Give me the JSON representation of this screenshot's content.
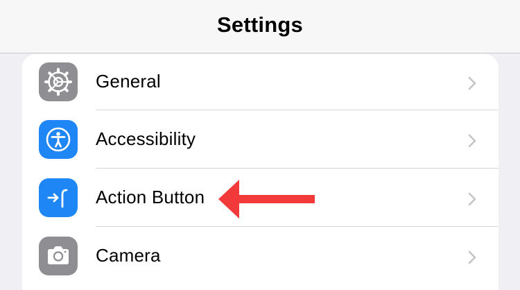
{
  "header": {
    "title": "Settings"
  },
  "rows": [
    {
      "label": "General",
      "icon": "gear-icon",
      "icon_bg": "#8e8e93"
    },
    {
      "label": "Accessibility",
      "icon": "accessibility-icon",
      "icon_bg": "#1f87f5"
    },
    {
      "label": "Action Button",
      "icon": "action-button-icon",
      "icon_bg": "#1f87f5"
    },
    {
      "label": "Camera",
      "icon": "camera-icon",
      "icon_bg": "#8e8e93"
    }
  ],
  "annotation": {
    "icon": "red-arrow-icon",
    "color": "#f23a3a",
    "points_to": "Action Button"
  },
  "colors": {
    "background": "#efeff4",
    "chevron": "#c4c4c7",
    "separator": "#d6d6da"
  }
}
